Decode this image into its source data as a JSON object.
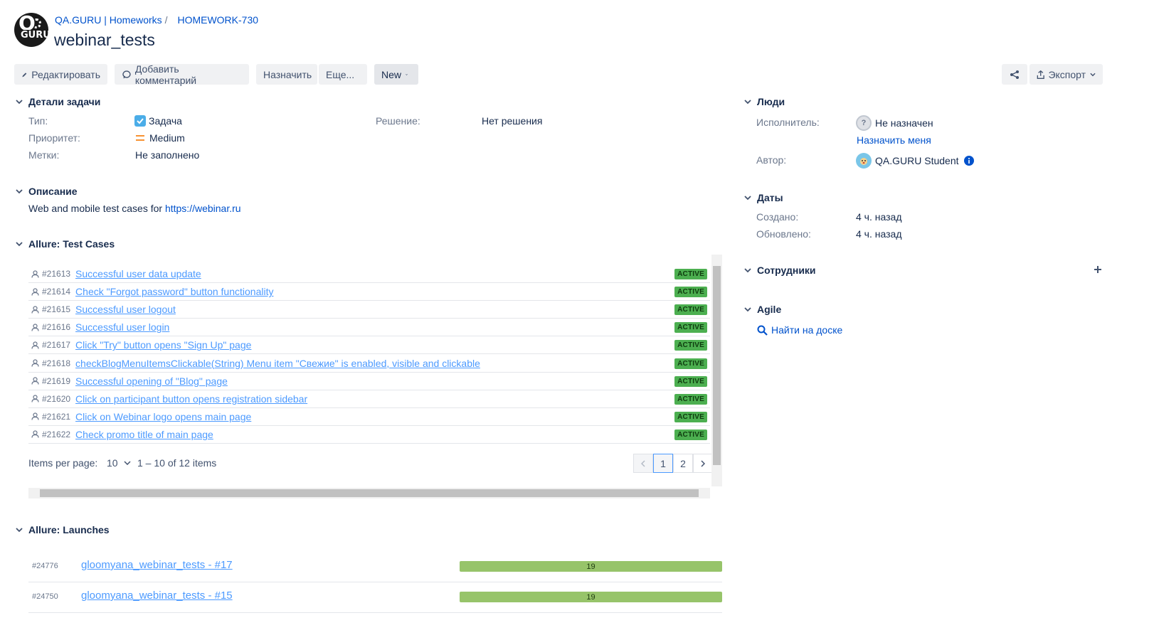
{
  "breadcrumbs": {
    "project": "QA.GURU | Homeworks",
    "issue_key": "HOMEWORK-730"
  },
  "title": "webinar_tests",
  "toolbar": {
    "edit": "Редактировать",
    "comment": "Добавить комментарий",
    "assign": "Назначить",
    "more": "Еще...",
    "status": "New",
    "export": "Экспорт"
  },
  "details": {
    "header": "Детали задачи",
    "type_label": "Тип:",
    "type_value": "Задача",
    "priority_label": "Приоритет:",
    "priority_value": "Medium",
    "labels_label": "Метки:",
    "labels_value": "Не заполнено",
    "resolution_label": "Решение:",
    "resolution_value": "Нет решения"
  },
  "description": {
    "header": "Описание",
    "text": "Web and mobile test cases for ",
    "link": "https://webinar.ru"
  },
  "test_cases": {
    "header": "Allure: Test Cases",
    "rows": [
      {
        "id": "#21613",
        "name": "Successful user data update",
        "status": "ACTIVE"
      },
      {
        "id": "#21614",
        "name": "Check \"Forgot password\" button functionality",
        "status": "ACTIVE"
      },
      {
        "id": "#21615",
        "name": "Successful user logout",
        "status": "ACTIVE"
      },
      {
        "id": "#21616",
        "name": "Successful user login",
        "status": "ACTIVE"
      },
      {
        "id": "#21617",
        "name": "Click \"Try\" button opens \"Sign Up\" page",
        "status": "ACTIVE"
      },
      {
        "id": "#21618",
        "name": "checkBlogMenuItemsClickable(String) Menu item \"Свежие\" is enabled, visible and clickable",
        "status": "ACTIVE"
      },
      {
        "id": "#21619",
        "name": "Successful opening of \"Blog\" page",
        "status": "ACTIVE"
      },
      {
        "id": "#21620",
        "name": "Click on participant button opens registration sidebar",
        "status": "ACTIVE"
      },
      {
        "id": "#21621",
        "name": "Click on Webinar logo opens main page",
        "status": "ACTIVE"
      },
      {
        "id": "#21622",
        "name": "Check promo title of main page",
        "status": "ACTIVE"
      }
    ],
    "items_per_page_label": "Items per page:",
    "items_per_page": "10",
    "range": "1 – 10 of 12 items",
    "pages": [
      "1",
      "2"
    ]
  },
  "launches": {
    "header": "Allure: Launches",
    "rows": [
      {
        "id": "#24776",
        "name": "gloomyana_webinar_tests - #17",
        "count": "19"
      },
      {
        "id": "#24750",
        "name": "gloomyana_webinar_tests - #15",
        "count": "19"
      }
    ]
  },
  "people": {
    "header": "Люди",
    "assignee_label": "Исполнитель:",
    "assignee_value": "Не назначен",
    "assign_me": "Назначить меня",
    "reporter_label": "Автор:",
    "reporter_value": "QA.GURU Student"
  },
  "dates": {
    "header": "Даты",
    "created_label": "Создано:",
    "created_value": "4 ч. назад",
    "updated_label": "Обновлено:",
    "updated_value": "4 ч. назад"
  },
  "watchers": {
    "header": "Сотрудники"
  },
  "agile": {
    "header": "Agile",
    "find_on_board": "Найти на доске"
  },
  "colors": {
    "link": "#0052cc",
    "active_badge": "#4caf50",
    "launch_bar": "#97c46a",
    "info": "#0052cc"
  }
}
